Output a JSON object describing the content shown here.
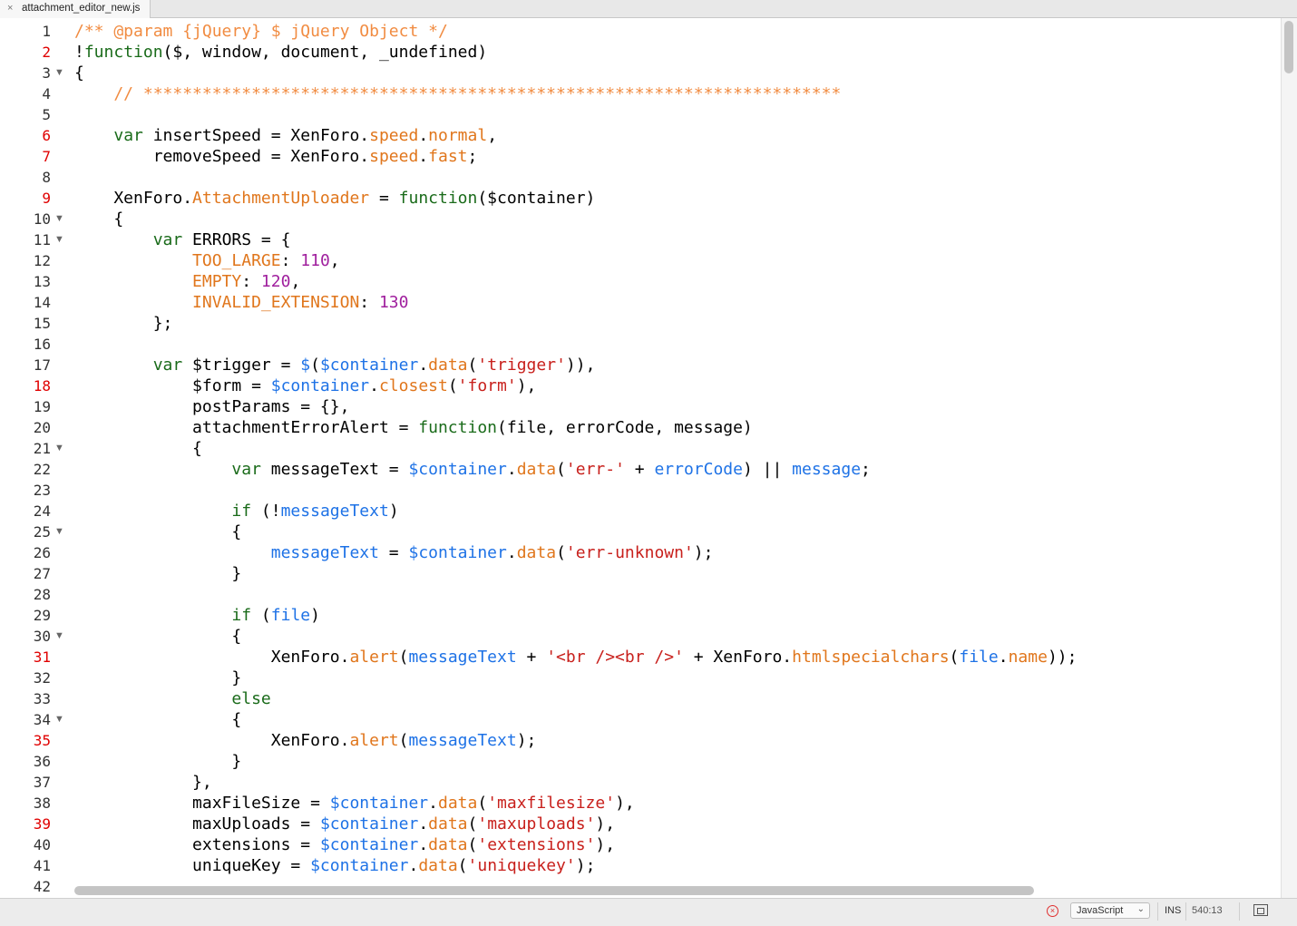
{
  "tab": {
    "close": "×",
    "title": "attachment_editor_new.js"
  },
  "lines": [
    {
      "n": "1",
      "bp": false,
      "fold": false,
      "tokens": [
        {
          "t": "/** @param {jQuery} $ jQuery Object */",
          "c": "c"
        }
      ]
    },
    {
      "n": "2",
      "bp": true,
      "fold": false,
      "tokens": [
        {
          "t": "!",
          "c": "x"
        },
        {
          "t": "function",
          "c": "k"
        },
        {
          "t": "($, window, document, _undefined)",
          "c": "x"
        }
      ]
    },
    {
      "n": "3",
      "bp": false,
      "fold": true,
      "tokens": [
        {
          "t": "{",
          "c": "x"
        }
      ]
    },
    {
      "n": "4",
      "bp": false,
      "fold": false,
      "tokens": [
        {
          "t": "    // ***********************************************************************",
          "c": "c"
        }
      ]
    },
    {
      "n": "5",
      "bp": false,
      "fold": false,
      "tokens": []
    },
    {
      "n": "6",
      "bp": true,
      "fold": false,
      "tokens": [
        {
          "t": "    ",
          "c": "x"
        },
        {
          "t": "var",
          "c": "k"
        },
        {
          "t": " insertSpeed = XenForo.",
          "c": "x"
        },
        {
          "t": "speed",
          "c": "p"
        },
        {
          "t": ".",
          "c": "x"
        },
        {
          "t": "normal",
          "c": "p"
        },
        {
          "t": ",",
          "c": "x"
        }
      ]
    },
    {
      "n": "7",
      "bp": true,
      "fold": false,
      "tokens": [
        {
          "t": "        removeSpeed = XenForo.",
          "c": "x"
        },
        {
          "t": "speed",
          "c": "p"
        },
        {
          "t": ".",
          "c": "x"
        },
        {
          "t": "fast",
          "c": "p"
        },
        {
          "t": ";",
          "c": "x"
        }
      ]
    },
    {
      "n": "8",
      "bp": false,
      "fold": false,
      "tokens": []
    },
    {
      "n": "9",
      "bp": true,
      "fold": false,
      "tokens": [
        {
          "t": "    XenForo.",
          "c": "x"
        },
        {
          "t": "AttachmentUploader",
          "c": "p"
        },
        {
          "t": " = ",
          "c": "x"
        },
        {
          "t": "function",
          "c": "k"
        },
        {
          "t": "($container)",
          "c": "x"
        }
      ]
    },
    {
      "n": "10",
      "bp": false,
      "fold": true,
      "tokens": [
        {
          "t": "    {",
          "c": "x"
        }
      ]
    },
    {
      "n": "11",
      "bp": false,
      "fold": true,
      "tokens": [
        {
          "t": "        ",
          "c": "x"
        },
        {
          "t": "var",
          "c": "k"
        },
        {
          "t": " ERRORS = {",
          "c": "x"
        }
      ]
    },
    {
      "n": "12",
      "bp": false,
      "fold": false,
      "tokens": [
        {
          "t": "            ",
          "c": "x"
        },
        {
          "t": "TOO_LARGE",
          "c": "p"
        },
        {
          "t": ": ",
          "c": "x"
        },
        {
          "t": "110",
          "c": "n"
        },
        {
          "t": ",",
          "c": "x"
        }
      ]
    },
    {
      "n": "13",
      "bp": false,
      "fold": false,
      "tokens": [
        {
          "t": "            ",
          "c": "x"
        },
        {
          "t": "EMPTY",
          "c": "p"
        },
        {
          "t": ": ",
          "c": "x"
        },
        {
          "t": "120",
          "c": "n"
        },
        {
          "t": ",",
          "c": "x"
        }
      ]
    },
    {
      "n": "14",
      "bp": false,
      "fold": false,
      "tokens": [
        {
          "t": "            ",
          "c": "x"
        },
        {
          "t": "INVALID_EXTENSION",
          "c": "p"
        },
        {
          "t": ": ",
          "c": "x"
        },
        {
          "t": "130",
          "c": "n"
        }
      ]
    },
    {
      "n": "15",
      "bp": false,
      "fold": false,
      "tokens": [
        {
          "t": "        };",
          "c": "x"
        }
      ]
    },
    {
      "n": "16",
      "bp": false,
      "fold": false,
      "tokens": []
    },
    {
      "n": "17",
      "bp": false,
      "fold": false,
      "tokens": [
        {
          "t": "        ",
          "c": "x"
        },
        {
          "t": "var",
          "c": "k"
        },
        {
          "t": " $trigger = ",
          "c": "x"
        },
        {
          "t": "$",
          "c": "v"
        },
        {
          "t": "(",
          "c": "x"
        },
        {
          "t": "$container",
          "c": "v"
        },
        {
          "t": ".",
          "c": "x"
        },
        {
          "t": "data",
          "c": "p"
        },
        {
          "t": "(",
          "c": "x"
        },
        {
          "t": "'trigger'",
          "c": "s"
        },
        {
          "t": ")),",
          "c": "x"
        }
      ]
    },
    {
      "n": "18",
      "bp": true,
      "fold": false,
      "tokens": [
        {
          "t": "            $form = ",
          "c": "x"
        },
        {
          "t": "$container",
          "c": "v"
        },
        {
          "t": ".",
          "c": "x"
        },
        {
          "t": "closest",
          "c": "p"
        },
        {
          "t": "(",
          "c": "x"
        },
        {
          "t": "'form'",
          "c": "s"
        },
        {
          "t": "),",
          "c": "x"
        }
      ]
    },
    {
      "n": "19",
      "bp": false,
      "fold": false,
      "tokens": [
        {
          "t": "            postParams = {},",
          "c": "x"
        }
      ]
    },
    {
      "n": "20",
      "bp": false,
      "fold": false,
      "tokens": [
        {
          "t": "            attachmentErrorAlert = ",
          "c": "x"
        },
        {
          "t": "function",
          "c": "k"
        },
        {
          "t": "(file, errorCode, message)",
          "c": "x"
        }
      ]
    },
    {
      "n": "21",
      "bp": false,
      "fold": true,
      "tokens": [
        {
          "t": "            {",
          "c": "x"
        }
      ]
    },
    {
      "n": "22",
      "bp": false,
      "fold": false,
      "tokens": [
        {
          "t": "                ",
          "c": "x"
        },
        {
          "t": "var",
          "c": "k"
        },
        {
          "t": " messageText = ",
          "c": "x"
        },
        {
          "t": "$container",
          "c": "v"
        },
        {
          "t": ".",
          "c": "x"
        },
        {
          "t": "data",
          "c": "p"
        },
        {
          "t": "(",
          "c": "x"
        },
        {
          "t": "'err-'",
          "c": "s"
        },
        {
          "t": " + ",
          "c": "x"
        },
        {
          "t": "errorCode",
          "c": "v"
        },
        {
          "t": ") || ",
          "c": "x"
        },
        {
          "t": "message",
          "c": "v"
        },
        {
          "t": ";",
          "c": "x"
        }
      ]
    },
    {
      "n": "23",
      "bp": false,
      "fold": false,
      "tokens": []
    },
    {
      "n": "24",
      "bp": false,
      "fold": false,
      "tokens": [
        {
          "t": "                ",
          "c": "x"
        },
        {
          "t": "if",
          "c": "k"
        },
        {
          "t": " (!",
          "c": "x"
        },
        {
          "t": "messageText",
          "c": "v"
        },
        {
          "t": ")",
          "c": "x"
        }
      ]
    },
    {
      "n": "25",
      "bp": false,
      "fold": true,
      "tokens": [
        {
          "t": "                {",
          "c": "x"
        }
      ]
    },
    {
      "n": "26",
      "bp": false,
      "fold": false,
      "tokens": [
        {
          "t": "                    ",
          "c": "x"
        },
        {
          "t": "messageText",
          "c": "v"
        },
        {
          "t": " = ",
          "c": "x"
        },
        {
          "t": "$container",
          "c": "v"
        },
        {
          "t": ".",
          "c": "x"
        },
        {
          "t": "data",
          "c": "p"
        },
        {
          "t": "(",
          "c": "x"
        },
        {
          "t": "'err-unknown'",
          "c": "s"
        },
        {
          "t": ");",
          "c": "x"
        }
      ]
    },
    {
      "n": "27",
      "bp": false,
      "fold": false,
      "tokens": [
        {
          "t": "                }",
          "c": "x"
        }
      ]
    },
    {
      "n": "28",
      "bp": false,
      "fold": false,
      "tokens": []
    },
    {
      "n": "29",
      "bp": false,
      "fold": false,
      "tokens": [
        {
          "t": "                ",
          "c": "x"
        },
        {
          "t": "if",
          "c": "k"
        },
        {
          "t": " (",
          "c": "x"
        },
        {
          "t": "file",
          "c": "v"
        },
        {
          "t": ")",
          "c": "x"
        }
      ]
    },
    {
      "n": "30",
      "bp": false,
      "fold": true,
      "tokens": [
        {
          "t": "                {",
          "c": "x"
        }
      ]
    },
    {
      "n": "31",
      "bp": true,
      "fold": false,
      "tokens": [
        {
          "t": "                    XenForo.",
          "c": "x"
        },
        {
          "t": "alert",
          "c": "p"
        },
        {
          "t": "(",
          "c": "x"
        },
        {
          "t": "messageText",
          "c": "v"
        },
        {
          "t": " + ",
          "c": "x"
        },
        {
          "t": "'<br /><br />'",
          "c": "s"
        },
        {
          "t": " + XenForo.",
          "c": "x"
        },
        {
          "t": "htmlspecialchars",
          "c": "p"
        },
        {
          "t": "(",
          "c": "x"
        },
        {
          "t": "file",
          "c": "v"
        },
        {
          "t": ".",
          "c": "x"
        },
        {
          "t": "name",
          "c": "p"
        },
        {
          "t": "));",
          "c": "x"
        }
      ]
    },
    {
      "n": "32",
      "bp": false,
      "fold": false,
      "tokens": [
        {
          "t": "                }",
          "c": "x"
        }
      ]
    },
    {
      "n": "33",
      "bp": false,
      "fold": false,
      "tokens": [
        {
          "t": "                ",
          "c": "x"
        },
        {
          "t": "else",
          "c": "k"
        }
      ]
    },
    {
      "n": "34",
      "bp": false,
      "fold": true,
      "tokens": [
        {
          "t": "                {",
          "c": "x"
        }
      ]
    },
    {
      "n": "35",
      "bp": true,
      "fold": false,
      "tokens": [
        {
          "t": "                    XenForo.",
          "c": "x"
        },
        {
          "t": "alert",
          "c": "p"
        },
        {
          "t": "(",
          "c": "x"
        },
        {
          "t": "messageText",
          "c": "v"
        },
        {
          "t": ");",
          "c": "x"
        }
      ]
    },
    {
      "n": "36",
      "bp": false,
      "fold": false,
      "tokens": [
        {
          "t": "                }",
          "c": "x"
        }
      ]
    },
    {
      "n": "37",
      "bp": false,
      "fold": false,
      "tokens": [
        {
          "t": "            },",
          "c": "x"
        }
      ]
    },
    {
      "n": "38",
      "bp": false,
      "fold": false,
      "tokens": [
        {
          "t": "            maxFileSize = ",
          "c": "x"
        },
        {
          "t": "$container",
          "c": "v"
        },
        {
          "t": ".",
          "c": "x"
        },
        {
          "t": "data",
          "c": "p"
        },
        {
          "t": "(",
          "c": "x"
        },
        {
          "t": "'maxfilesize'",
          "c": "s"
        },
        {
          "t": "),",
          "c": "x"
        }
      ]
    },
    {
      "n": "39",
      "bp": true,
      "fold": false,
      "tokens": [
        {
          "t": "            maxUploads = ",
          "c": "x"
        },
        {
          "t": "$container",
          "c": "v"
        },
        {
          "t": ".",
          "c": "x"
        },
        {
          "t": "data",
          "c": "p"
        },
        {
          "t": "(",
          "c": "x"
        },
        {
          "t": "'maxuploads'",
          "c": "s"
        },
        {
          "t": "),",
          "c": "x"
        }
      ]
    },
    {
      "n": "40",
      "bp": false,
      "fold": false,
      "tokens": [
        {
          "t": "            extensions = ",
          "c": "x"
        },
        {
          "t": "$container",
          "c": "v"
        },
        {
          "t": ".",
          "c": "x"
        },
        {
          "t": "data",
          "c": "p"
        },
        {
          "t": "(",
          "c": "x"
        },
        {
          "t": "'extensions'",
          "c": "s"
        },
        {
          "t": "),",
          "c": "x"
        }
      ]
    },
    {
      "n": "41",
      "bp": false,
      "fold": false,
      "tokens": [
        {
          "t": "            uniqueKey = ",
          "c": "x"
        },
        {
          "t": "$container",
          "c": "v"
        },
        {
          "t": ".",
          "c": "x"
        },
        {
          "t": "data",
          "c": "p"
        },
        {
          "t": "(",
          "c": "x"
        },
        {
          "t": "'uniquekey'",
          "c": "s"
        },
        {
          "t": ");",
          "c": "x"
        }
      ]
    },
    {
      "n": "42",
      "bp": false,
      "fold": false,
      "tokens": []
    }
  ],
  "status": {
    "error_icon": "error-icon",
    "error_glyph": "×",
    "language": "JavaScript",
    "mode": "INS",
    "cursor": "540:13"
  },
  "colors": {
    "comment": "#f18c42",
    "keyword": "#1a6b1a",
    "property": "#e0761c",
    "number": "#a0209e",
    "string": "#c8201c",
    "variable": "#1e72e6",
    "breakpoint_line_number": "#e00000"
  }
}
